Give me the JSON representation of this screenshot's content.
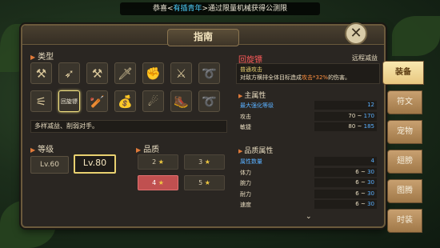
{
  "banner": {
    "prefix": "恭喜<",
    "player": "有插青年",
    "suffix": ">通过限量机械获得公测限"
  },
  "panel": {
    "title": "指南",
    "close_icon": "close-icon"
  },
  "type_section": {
    "label": "类型",
    "items": [
      {
        "icon": "hammer-icon",
        "glyph": "⚒"
      },
      {
        "icon": "bow-icon",
        "glyph": "➶"
      },
      {
        "icon": "axe-icon",
        "glyph": "⚒"
      },
      {
        "icon": "dagger-icon",
        "glyph": "🗡"
      },
      {
        "icon": "fist-icon",
        "glyph": "✊"
      },
      {
        "icon": "crossbow-icon",
        "glyph": "⚔"
      },
      {
        "icon": "whip-icon",
        "glyph": "➰"
      },
      {
        "icon": "claw-icon",
        "glyph": "⚟"
      },
      {
        "icon": "boomerang-text",
        "text": "回旋镖"
      },
      {
        "icon": "club-icon",
        "glyph": "🏏"
      },
      {
        "icon": "bag-icon",
        "glyph": "💰"
      },
      {
        "icon": "cannon-icon",
        "glyph": "☄"
      },
      {
        "icon": "pouch-icon",
        "glyph": "🥾"
      },
      {
        "icon": "rope-icon",
        "glyph": "➰"
      }
    ],
    "selected_index": 8,
    "description": "多样减益、削弱对手。"
  },
  "level_section": {
    "label": "等级",
    "options": [
      "Lv.60",
      "Lv.80"
    ],
    "selected": "Lv.80"
  },
  "quality_section": {
    "label": "品质",
    "options": [
      "2",
      "3",
      "4",
      "5"
    ],
    "selected": "4"
  },
  "item": {
    "name": "回旋镖",
    "class": "远程减益",
    "skill_name": "普通攻击",
    "skill_desc_pre": "对敌方横排全体目标造成",
    "skill_desc_hl": "攻击*32%",
    "skill_desc_post": "的伤害。"
  },
  "main_attributes": {
    "label": "主属性",
    "rows": [
      {
        "label": "最大强化等级",
        "value": "12",
        "blue": true
      },
      {
        "label": "攻击",
        "min": "70",
        "max": "170"
      },
      {
        "label": "敏捷",
        "min": "80",
        "max": "185"
      }
    ]
  },
  "quality_attributes": {
    "label": "品质属性",
    "rows": [
      {
        "label": "属性数量",
        "value": "4",
        "blue": true
      },
      {
        "label": "体力",
        "min": "6",
        "max": "30"
      },
      {
        "label": "腕力",
        "min": "6",
        "max": "30"
      },
      {
        "label": "耐力",
        "min": "6",
        "max": "30"
      },
      {
        "label": "速度",
        "min": "6",
        "max": "30"
      }
    ]
  },
  "side_tabs": [
    "装备",
    "符文",
    "宠物",
    "翅膀",
    "图腾",
    "时装"
  ],
  "active_tab": "装备",
  "colors": {
    "accent_red": "#ff5a5a",
    "stat_blue": "#5ab0ff",
    "highlight": "#e8d070"
  }
}
